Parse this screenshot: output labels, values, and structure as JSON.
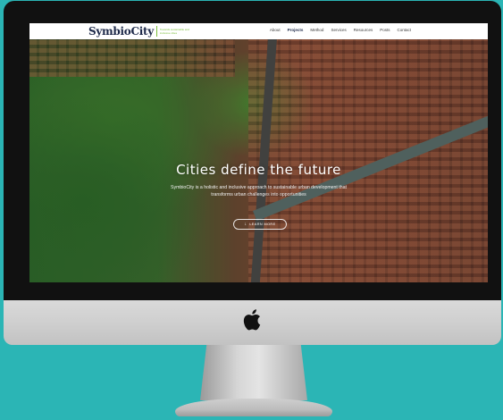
{
  "site": {
    "logo": "SymbioCity",
    "tagline": "Towards sustainable and inclusive cities"
  },
  "nav": {
    "items": [
      {
        "label": "About"
      },
      {
        "label": "Projects"
      },
      {
        "label": "Method"
      },
      {
        "label": "Services"
      },
      {
        "label": "Resources"
      },
      {
        "label": "Posts"
      },
      {
        "label": "Contact"
      }
    ]
  },
  "hero": {
    "title": "Cities define the future",
    "subtitle": "SymbioCity is a holistic and inclusive approach to sustainable urban development that transforms urban challenges into opportunities",
    "button_label": "LEARN MORE"
  },
  "icons": {
    "learn_more": "arrow-down-icon",
    "device": "apple-logo-icon"
  },
  "colors": {
    "background": "#2bb5b5",
    "logo_text": "#1e2a4a",
    "accent_green": "#7bbf3a"
  }
}
